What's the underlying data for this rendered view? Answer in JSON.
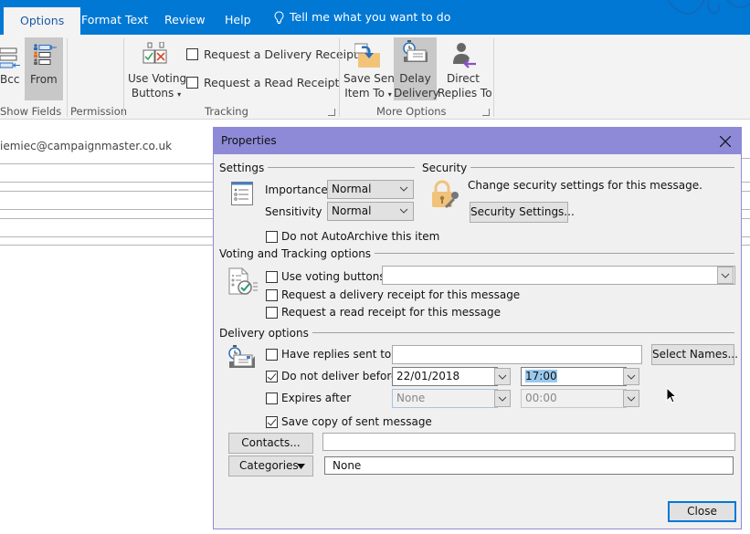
{
  "tabs": {
    "items": [
      {
        "label": "Options",
        "active": true
      },
      {
        "label": "Format Text",
        "active": false
      },
      {
        "label": "Review",
        "active": false
      },
      {
        "label": "Help",
        "active": false
      }
    ],
    "tell_me": "Tell me what you want to do"
  },
  "ribbon": {
    "show_fields": {
      "group_label": "Show Fields",
      "bcc_label": "Bcc",
      "from_label": "From"
    },
    "permission": {
      "group_label": "Permission"
    },
    "tracking": {
      "group_label": "Tracking",
      "voting_label_line1": "Use Voting",
      "voting_label_line2": "Buttons",
      "delivery_receipt": {
        "label": "Request a Delivery Receipt",
        "checked": false
      },
      "read_receipt": {
        "label": "Request a Read Receipt",
        "checked": false
      }
    },
    "more_options": {
      "group_label": "More Options",
      "save_sent_line1": "Save Sent",
      "save_sent_line2": "Item To",
      "delay_line1": "Delay",
      "delay_line2": "Delivery",
      "direct_line1": "Direct",
      "direct_line2": "Replies To"
    }
  },
  "message": {
    "from_address": "iemiec@campaignmaster.co.uk"
  },
  "dialog": {
    "title": "Properties",
    "settings": {
      "heading": "Settings",
      "importance_label": "Importance",
      "importance_value": "Normal",
      "sensitivity_label": "Sensitivity",
      "sensitivity_value": "Normal",
      "autoarchive": {
        "label": "Do not AutoArchive this item",
        "checked": false
      }
    },
    "security": {
      "heading": "Security",
      "description": "Change security settings for this message.",
      "button_label": "Security Settings..."
    },
    "voting": {
      "heading": "Voting and Tracking options",
      "use_voting": {
        "label": "Use voting buttons",
        "checked": false
      },
      "voting_value": "",
      "delivery_receipt": {
        "label": "Request a delivery receipt for this message",
        "checked": false
      },
      "read_receipt": {
        "label": "Request a read receipt for this message",
        "checked": false
      }
    },
    "delivery": {
      "heading": "Delivery options",
      "replies_sent_to": {
        "label": "Have replies sent to",
        "checked": false,
        "value": ""
      },
      "select_names_label": "Select Names...",
      "do_not_deliver": {
        "label": "Do not deliver before",
        "checked": true,
        "date": "22/01/2018",
        "time": "17:00"
      },
      "expires_after": {
        "label": "Expires after",
        "checked": false,
        "date": "None",
        "time": "00:00"
      },
      "save_copy": {
        "label": "Save copy of sent message",
        "checked": true
      }
    },
    "contacts_label": "Contacts...",
    "contacts_value": "",
    "categories_label": "Categories",
    "categories_value": "None",
    "close_label": "Close"
  },
  "colors": {
    "tab_bar": "#0078d4",
    "dialog_accent": "#8e8ad8",
    "default_button_border": "#0078d7",
    "selection_highlight": "#99c9ef"
  }
}
